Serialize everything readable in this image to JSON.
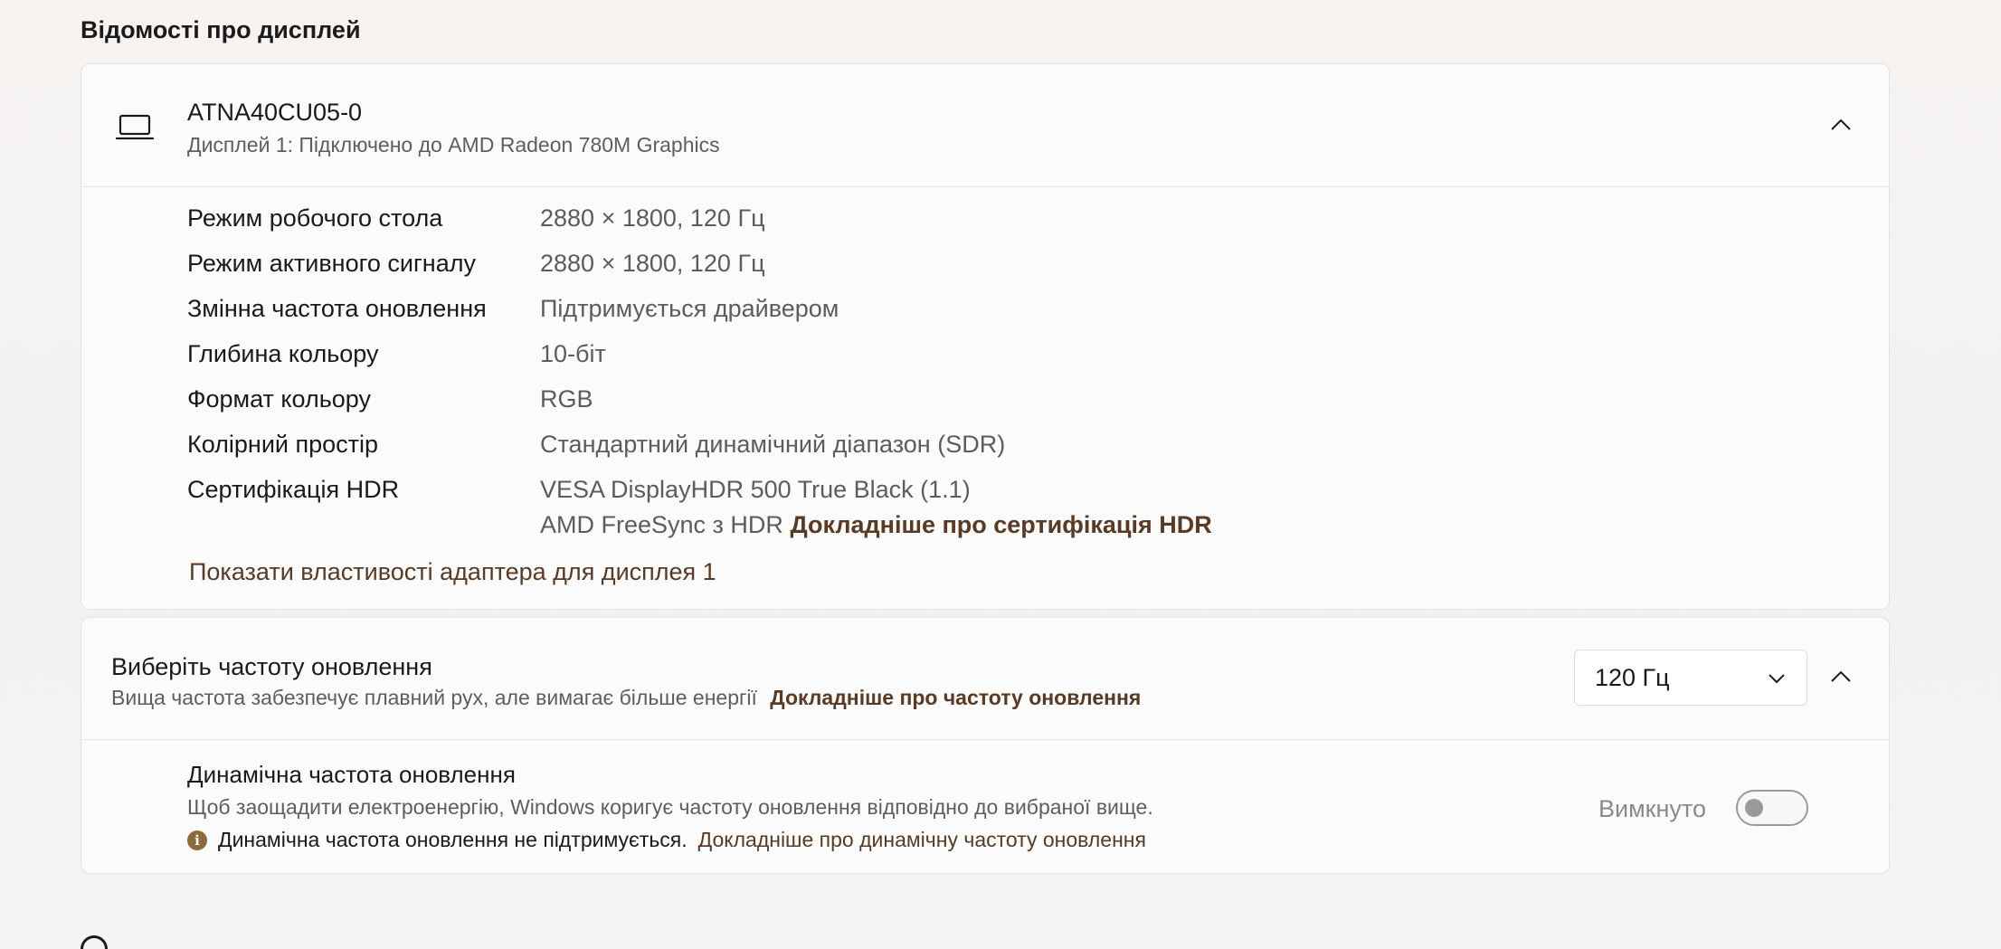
{
  "section": {
    "title": "Відомості про дисплей"
  },
  "display": {
    "name": "ATNA40CU05-0",
    "subtitle": "Дисплей 1: Підключено до AMD Radeon 780M Graphics",
    "properties": [
      {
        "label": "Режим робочого стола",
        "value": "2880 × 1800, 120 Гц"
      },
      {
        "label": "Режим активного сигналу",
        "value": "2880 × 1800, 120 Гц"
      },
      {
        "label": "Змінна частота оновлення",
        "value": "Підтримується драйвером"
      },
      {
        "label": "Глибина кольору",
        "value": "10-біт"
      },
      {
        "label": "Формат кольору",
        "value": "RGB"
      },
      {
        "label": "Колірний простір",
        "value": "Стандартний динамічний діапазон (SDR)"
      }
    ],
    "hdr": {
      "label": "Сертифікація HDR",
      "line1": "VESA DisplayHDR 500 True Black (1.1)",
      "line2": "AMD FreeSync з HDR",
      "link": "Докладніше про сертифікація HDR"
    },
    "adapter_link": "Показати властивості адаптера для дисплея 1"
  },
  "refresh": {
    "title": "Виберіть частоту оновлення",
    "subtitle": "Вища частота забезпечує плавний рух, але вимагає більше енергії",
    "link": "Докладніше про частоту оновлення",
    "selected": "120 Гц"
  },
  "dynamic": {
    "title": "Динамічна частота оновлення",
    "subtitle": "Щоб заощадити електроенергію, Windows коригує частоту оновлення відповідно до вибраної вище.",
    "note": "Динамічна частота оновлення не підтримується.",
    "note_link": "Докладніше про динамічну частоту оновлення",
    "toggle_label": "Вимкнуто",
    "toggle_on": false
  },
  "icons": {
    "display": "laptop-icon",
    "collapse": "chevron-up-icon",
    "dropdown": "chevron-down-icon",
    "info": "info-icon"
  },
  "colors": {
    "accent": "#5a3a22",
    "info": "#8c6a3c"
  }
}
